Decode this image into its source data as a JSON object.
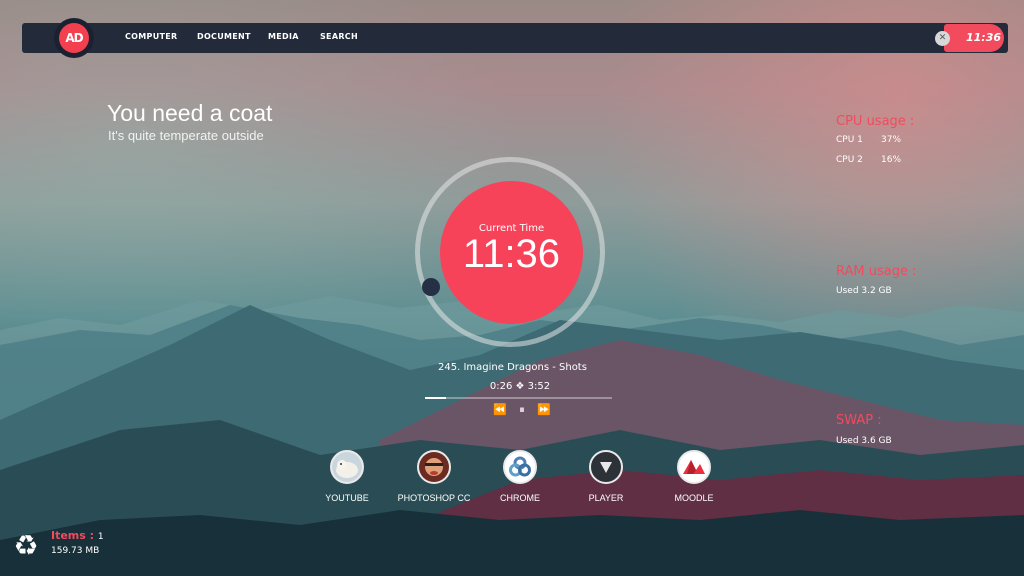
{
  "nav": {
    "logo": "AD",
    "items": [
      "COMPUTER",
      "DOCUMENT",
      "MEDIA",
      "SEARCH"
    ],
    "clock": "11:36",
    "close_icon": "close-icon"
  },
  "weather": {
    "title": "You need a coat",
    "subtitle": "It's quite temperate outside"
  },
  "clock": {
    "label": "Current Time",
    "time": "11:36"
  },
  "player": {
    "track": "245. Imagine Dragons - Shots",
    "time": "0:26 ❖ 3:52",
    "progress": 0.11,
    "controls": [
      "⏪",
      "⏸",
      "⏩"
    ]
  },
  "stats": {
    "cpu_header": "CPU usage :",
    "cpu": [
      {
        "label": "CPU 1",
        "value": "37%"
      },
      {
        "label": "CPU 2",
        "value": "16%"
      }
    ],
    "ram_header": "RAM usage :",
    "ram_value": "Used 3.2 GB",
    "swap_header": "SWAP :",
    "swap_value": "Used 3.6 GB"
  },
  "apps": [
    {
      "label": "YOUTUBE",
      "icon": "polar-bear-icon"
    },
    {
      "label": "PHOTOSHOP CC",
      "icon": "portrait-icon"
    },
    {
      "label": "CHROME",
      "icon": "chrome-icon"
    },
    {
      "label": "PLAYER",
      "icon": "play-triangle-icon"
    },
    {
      "label": "MOODLE",
      "icon": "moodle-icon"
    }
  ],
  "recycle": {
    "items_label": "Items :",
    "items_count": "1",
    "size": "159.73 MB"
  },
  "colors": {
    "accent": "#f14b5d",
    "bar": "#232a3a"
  }
}
